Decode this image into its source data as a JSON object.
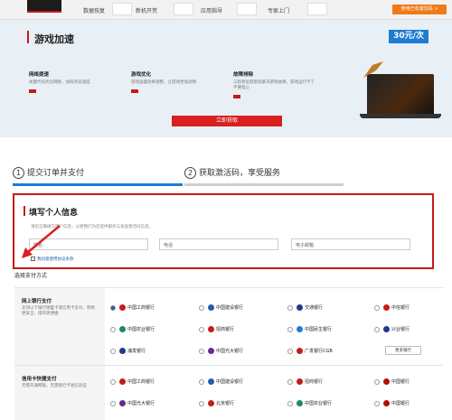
{
  "nav": {
    "items": [
      "数据恢复",
      "新机开荒",
      "应用指导",
      "专家上门"
    ],
    "right_button": "使用已有激活码 >"
  },
  "hero": {
    "title": "游戏加速",
    "price": "30元/次",
    "features": [
      {
        "title": "网络提速",
        "desc": "关键代码优化网络，加快浏览速度"
      },
      {
        "title": "游戏优化",
        "desc": "游戏画面效果调整，让游戏更加流畅"
      },
      {
        "title": "故障排除",
        "desc": "工程师远程帮您解决游戏故障，游戏运行不了不要担心"
      }
    ],
    "cta": "立即获取"
  },
  "steps": [
    {
      "num": "1",
      "label": "提交订单并支付"
    },
    {
      "num": "2",
      "label": "获取激活码，享受服务"
    }
  ],
  "form": {
    "title": "填写个人信息",
    "hint": "请您正确填写用户信息，以便我们为您提供服务与发送激活码信息。",
    "name_placeholder": "姓名",
    "phone_placeholder": "电话",
    "email_placeholder": "电子邮箱",
    "agree": "我同意使用协议条款"
  },
  "payment": {
    "title": "选择支付方式",
    "online": {
      "title": "网上银行支付",
      "desc": "支持以下银行储蓄卡或信用卡支付，购物更安全，操作更便捷",
      "banks": [
        "中国工商银行",
        "中国建设银行",
        "交通银行",
        "中信银行",
        "中国农业银行",
        "招商银行",
        "中国民生银行",
        "兴业银行",
        "浦发银行",
        "中国光大银行",
        "广发银行CGB"
      ],
      "more": "更多银行"
    },
    "card": {
      "title": "信用卡快捷支付",
      "desc": "无需开通网银，无需银行卡短信验证",
      "banks": [
        "中国工商银行",
        "中国建设银行",
        "招商银行",
        "中国银行",
        "中国光大银行",
        "北京银行",
        "中国农业银行",
        "中国银行"
      ]
    }
  },
  "colors": {
    "accent": "#c71a1a",
    "blue": "#1e7bd2",
    "orange": "#f07a19"
  }
}
